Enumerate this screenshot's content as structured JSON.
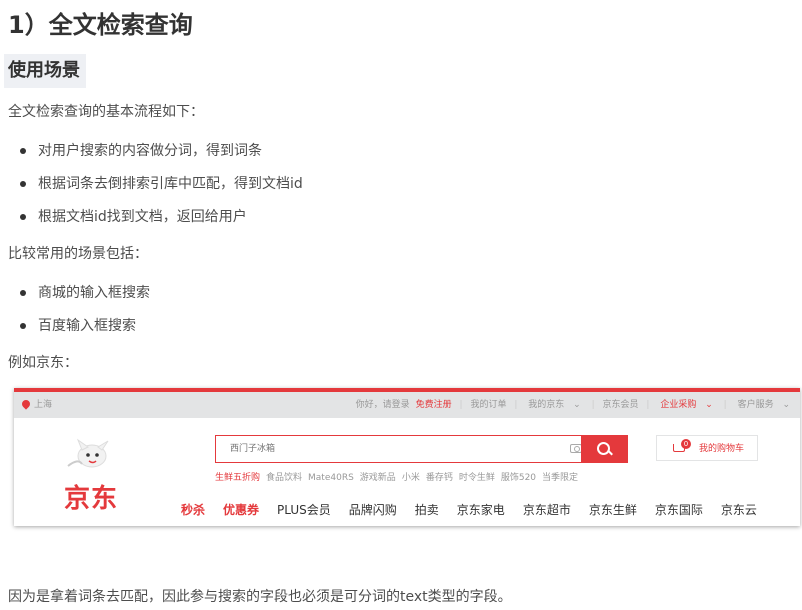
{
  "heading": "1）全文检索查询",
  "subheading": "使用场景",
  "intro": "全文检索查询的基本流程如下：",
  "steps": [
    "对用户搜索的内容做分词，得到词条",
    "根据词条去倒排索引库中匹配，得到文档id",
    "根据文档id找到文档，返回给用户"
  ],
  "scenarios_intro": "比较常用的场景包括：",
  "scenarios": [
    "商城的输入框搜索",
    "百度输入框搜索"
  ],
  "example_label": "例如京东：",
  "jd": {
    "location": "上海",
    "topnav": {
      "greeting": "你好，请登录",
      "register": "免费注册",
      "orders": "我的订单",
      "my_jd": "我的京东",
      "member": "京东会员",
      "enterprise": "企业采购",
      "service": "客户服务"
    },
    "logo": "京东",
    "search": {
      "placeholder": "西门子冰箱"
    },
    "hot_keywords": [
      "生鲜五折购",
      "食品饮料",
      "Mate40RS",
      "游戏新品",
      "小米",
      "番存钙",
      "时令生鲜",
      "服饰520",
      "当季限定"
    ],
    "cart": {
      "count": "0",
      "label": "我的购物车"
    },
    "categories": [
      "秒杀",
      "优惠券",
      "PLUS会员",
      "品牌闪购",
      "拍卖",
      "京东家电",
      "京东超市",
      "京东生鲜",
      "京东国际",
      "京东云"
    ],
    "colors": {
      "accent": "#e4393c",
      "topbar_bg": "#e3e4e5"
    }
  },
  "conclusion": "因为是拿着词条去匹配，因此参与搜索的字段也必须是可分词的text类型的字段。"
}
